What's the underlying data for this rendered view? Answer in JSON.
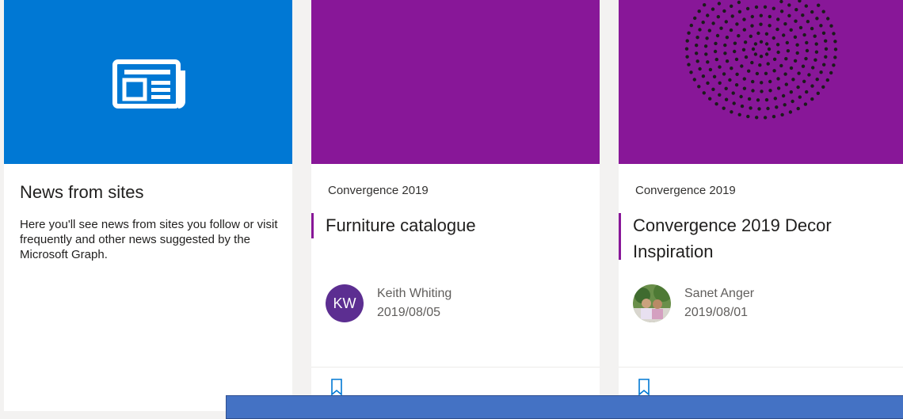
{
  "intro_card": {
    "icon": "newspaper-icon",
    "title": "News from sites",
    "description": "Here you'll see news from sites you follow or visit frequently and other news suggested by the Microsoft Graph."
  },
  "news_cards": [
    {
      "site": "Convergence 2019",
      "title": "Furniture catalogue",
      "author": "Keith Whiting",
      "date": "2019/08/05",
      "avatar_initials": "KW"
    },
    {
      "site": "Convergence 2019",
      "title": "Convergence 2019 Decor Inspiration",
      "author": "Sanet Anger",
      "date": "2019/08/01"
    }
  ],
  "colors": {
    "blue": "#0078d4",
    "purple": "#881798",
    "avatar": "#5c2e91",
    "banner": "#4472c4"
  }
}
